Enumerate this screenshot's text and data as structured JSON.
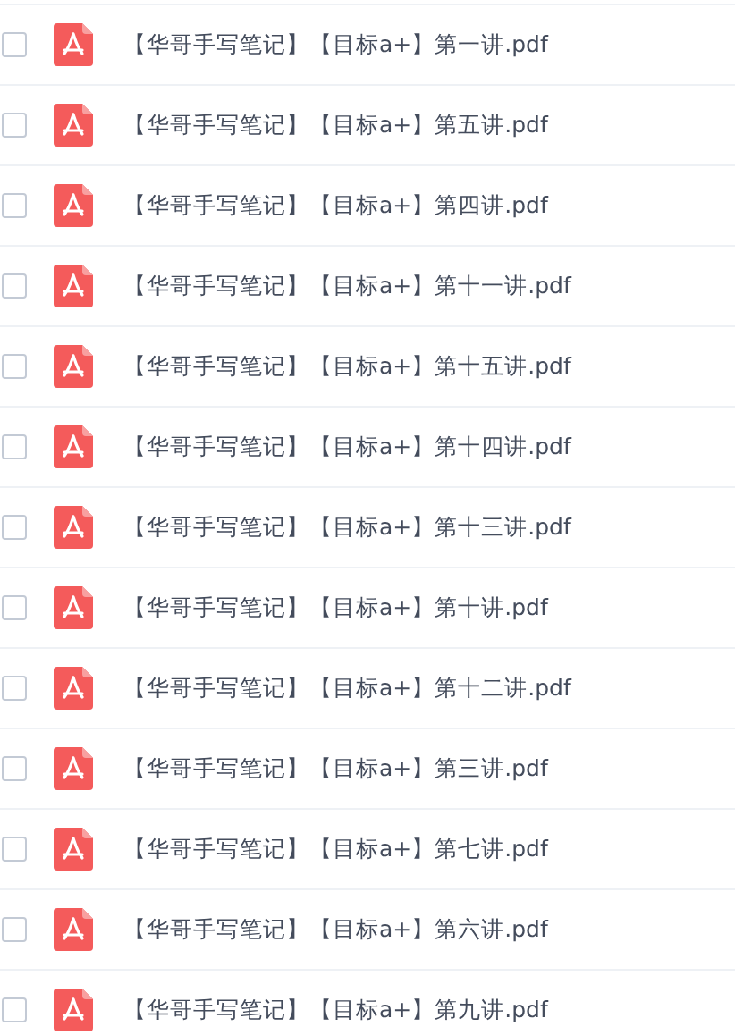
{
  "files": [
    {
      "name": "【华哥手写笔记】【目标a+】第一讲.pdf",
      "checked": false
    },
    {
      "name": "【华哥手写笔记】【目标a+】第五讲.pdf",
      "checked": false
    },
    {
      "name": "【华哥手写笔记】【目标a+】第四讲.pdf",
      "checked": false
    },
    {
      "name": "【华哥手写笔记】【目标a+】第十一讲.pdf",
      "checked": false
    },
    {
      "name": "【华哥手写笔记】【目标a+】第十五讲.pdf",
      "checked": false
    },
    {
      "name": "【华哥手写笔记】【目标a+】第十四讲.pdf",
      "checked": false
    },
    {
      "name": "【华哥手写笔记】【目标a+】第十三讲.pdf",
      "checked": false
    },
    {
      "name": "【华哥手写笔记】【目标a+】第十讲.pdf",
      "checked": false
    },
    {
      "name": "【华哥手写笔记】【目标a+】第十二讲.pdf",
      "checked": false
    },
    {
      "name": "【华哥手写笔记】【目标a+】第三讲.pdf",
      "checked": false
    },
    {
      "name": "【华哥手写笔记】【目标a+】第七讲.pdf",
      "checked": false
    },
    {
      "name": "【华哥手写笔记】【目标a+】第六讲.pdf",
      "checked": false
    },
    {
      "name": "【华哥手写笔记】【目标a+】第九讲.pdf",
      "checked": false
    }
  ]
}
